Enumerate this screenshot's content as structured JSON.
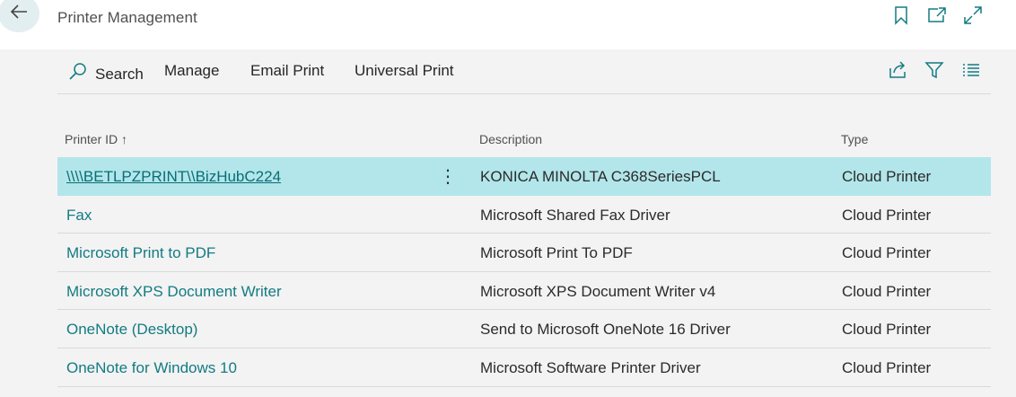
{
  "header": {
    "title": "Printer Management",
    "back_icon": "back-arrow-icon",
    "icons": [
      "bookmark-icon",
      "open-new-window-icon",
      "expand-icon"
    ]
  },
  "actionbar": {
    "search_label": "Search",
    "manage_label": "Manage",
    "email_print_label": "Email Print",
    "universal_print_label": "Universal Print",
    "right_icons": [
      "share-icon",
      "filter-icon",
      "list-view-icon"
    ]
  },
  "table": {
    "columns": {
      "printer_id": "Printer ID",
      "sort_indicator": "↑",
      "description": "Description",
      "type": "Type"
    },
    "rows": [
      {
        "printer_id": "\\\\\\\\BETLPZPRINT\\\\BizHubC224",
        "description": "KONICA MINOLTA C368SeriesPCL",
        "type": "Cloud Printer",
        "selected": true
      },
      {
        "printer_id": "Fax",
        "description": "Microsoft Shared Fax Driver",
        "type": "Cloud Printer"
      },
      {
        "printer_id": "Microsoft Print to PDF",
        "description": "Microsoft Print To PDF",
        "type": "Cloud Printer"
      },
      {
        "printer_id": "Microsoft XPS Document Writer",
        "description": "Microsoft XPS Document Writer v4",
        "type": "Cloud Printer"
      },
      {
        "printer_id": "OneNote (Desktop)",
        "description": "Send to Microsoft OneNote 16 Driver",
        "type": "Cloud Printer"
      },
      {
        "printer_id": "OneNote for Windows 10",
        "description": "Microsoft Software Printer Driver",
        "type": "Cloud Printer"
      }
    ]
  },
  "colors": {
    "accent": "#137b82",
    "selected_row": "#b2e6ea",
    "background": "#f3f3f3"
  }
}
